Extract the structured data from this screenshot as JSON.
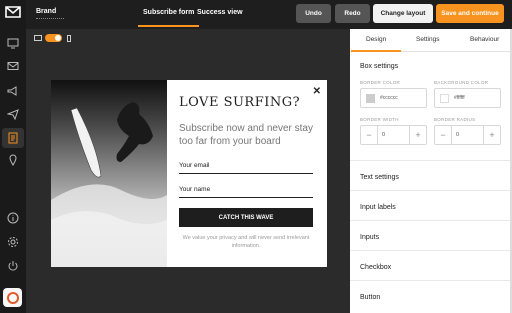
{
  "header": {
    "brand": "Brand",
    "tabs": [
      "Subscribe form",
      "Success view"
    ],
    "buttons": {
      "undo": "Undo",
      "redo": "Redo",
      "change_layout": "Change layout",
      "save": "Save and continue"
    }
  },
  "rail": {
    "icons": [
      "desktop-icon",
      "envelope-icon",
      "megaphone-icon",
      "paper-plane-icon",
      "form-icon",
      "pin-icon",
      "info-icon",
      "gear-icon",
      "power-icon"
    ]
  },
  "popup": {
    "title": "LOVE SURFING?",
    "subtitle": "Subscribe now and never stay too far from your board",
    "email_label": "Your email",
    "name_label": "Your name",
    "button": "CATCH THIS WAVE",
    "privacy": "We value your privacy and will never send irrelevant information.",
    "close": "✕"
  },
  "panel": {
    "tabs": [
      "Design",
      "Settings",
      "Behaviour"
    ],
    "box_settings": {
      "title": "Box settings",
      "border_color_label": "BORDER COLOR",
      "border_color_value": "#cccccc",
      "background_color_label": "BACKGROUND COLOR",
      "background_color_value": "#ffffff",
      "border_width_label": "BORDER WIDTH",
      "border_width_value": "0",
      "border_radius_label": "BORDER RADIUS",
      "border_radius_value": "0"
    },
    "sections": [
      "Text settings",
      "Input labels",
      "Inputs",
      "Checkbox",
      "Button"
    ]
  },
  "colors": {
    "accent": "#f7931e",
    "dark": "#1e1e1e"
  }
}
